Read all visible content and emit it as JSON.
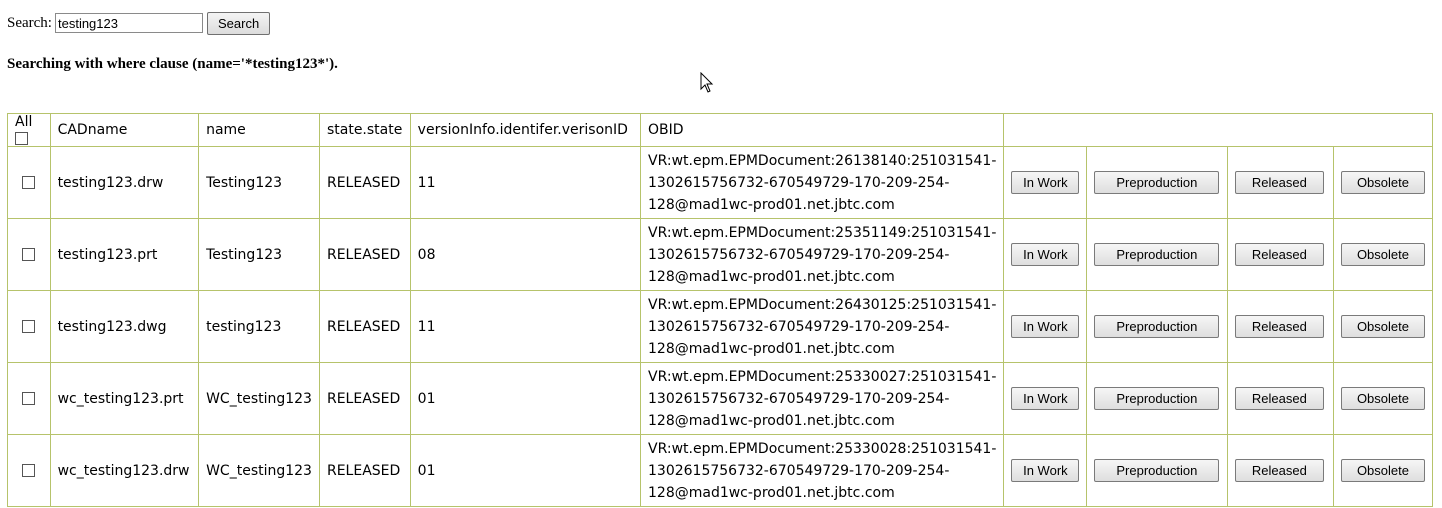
{
  "search": {
    "label": "Search:",
    "value": "testing123",
    "button": "Search"
  },
  "where_clause": "Searching with where clause (name='*testing123*').",
  "table": {
    "headers": {
      "all": "All",
      "cadname": "CADname",
      "name": "name",
      "state": "state.state",
      "version": "versionInfo.identifer.verisonID",
      "obid": "OBID"
    },
    "buttons": {
      "in_work": "In Work",
      "preproduction": "Preproduction",
      "released": "Released",
      "obsolete": "Obsolete"
    },
    "rows": [
      {
        "cadname": "testing123.drw",
        "name": "Testing123",
        "state": "RELEASED",
        "version": "11",
        "obid_1": "VR:wt.epm.EPMDocument:26138140:251031541-",
        "obid_2": "1302615756732-670549729-170-209-254-",
        "obid_3": "128@mad1wc-prod01.net.jbtc.com"
      },
      {
        "cadname": "testing123.prt",
        "name": "Testing123",
        "state": "RELEASED",
        "version": "08",
        "obid_1": "VR:wt.epm.EPMDocument:25351149:251031541-",
        "obid_2": "1302615756732-670549729-170-209-254-",
        "obid_3": "128@mad1wc-prod01.net.jbtc.com"
      },
      {
        "cadname": "testing123.dwg",
        "name": "testing123",
        "state": "RELEASED",
        "version": "11",
        "obid_1": "VR:wt.epm.EPMDocument:26430125:251031541-",
        "obid_2": "1302615756732-670549729-170-209-254-",
        "obid_3": "128@mad1wc-prod01.net.jbtc.com"
      },
      {
        "cadname": "wc_testing123.prt",
        "name": "WC_testing123",
        "state": "RELEASED",
        "version": "01",
        "obid_1": "VR:wt.epm.EPMDocument:25330027:251031541-",
        "obid_2": "1302615756732-670549729-170-209-254-",
        "obid_3": "128@mad1wc-prod01.net.jbtc.com"
      },
      {
        "cadname": "wc_testing123.drw",
        "name": "WC_testing123",
        "state": "RELEASED",
        "version": "01",
        "obid_1": "VR:wt.epm.EPMDocument:25330028:251031541-",
        "obid_2": "1302615756732-670549729-170-209-254-",
        "obid_3": "128@mad1wc-prod01.net.jbtc.com"
      }
    ]
  }
}
